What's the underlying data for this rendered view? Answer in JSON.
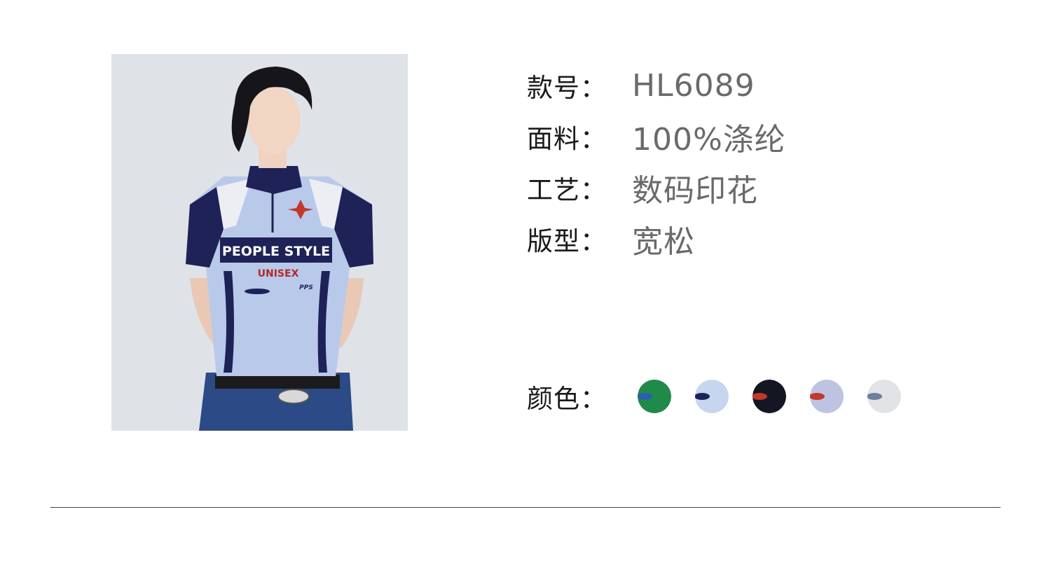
{
  "product_photo": {
    "shirt_print_main": "PEOPLE STYLE",
    "shirt_print_sub": "UNISEX",
    "shirt_print_small": "PPS"
  },
  "specs": [
    {
      "label": "款号：",
      "value": "HL6089"
    },
    {
      "label": "面料：",
      "value": "100%涤纶"
    },
    {
      "label": "工艺：",
      "value": "数码印花"
    },
    {
      "label": "版型：",
      "value": "宽松"
    }
  ],
  "colors": {
    "label": "颜色：",
    "swatches": [
      {
        "name": "green",
        "base": "#1f8a4a",
        "logo": "#2a5fb0"
      },
      {
        "name": "light-blue",
        "base": "#c6d6ee",
        "logo": "#1e2257"
      },
      {
        "name": "navy-black",
        "base": "#141624",
        "logo": "#c0392b"
      },
      {
        "name": "lavender",
        "base": "#bfc3e2",
        "logo": "#c0392b"
      },
      {
        "name": "light-grey",
        "base": "#e2e3e6",
        "logo": "#6d7f9c"
      }
    ]
  }
}
